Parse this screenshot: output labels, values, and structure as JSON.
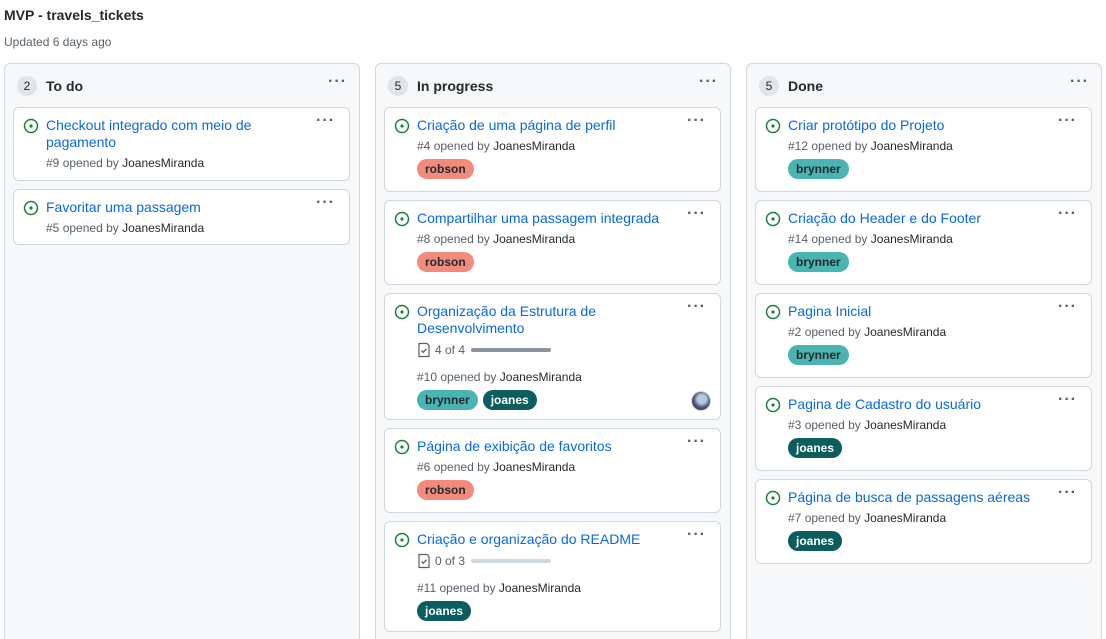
{
  "project": {
    "title": "MVP - travels_tickets",
    "updated": "Updated 6 days ago"
  },
  "colors": {
    "link": "#0969da",
    "issue_open": "#1a7f37",
    "robson": "#f28b7c",
    "brynner": "#49b4b2",
    "joanes": "#0b5e5d"
  },
  "icons": {
    "issue": "issue-opened-icon",
    "menu": "kebab-horizontal-icon",
    "checklist": "checklist-icon"
  },
  "columns": [
    {
      "count": "2",
      "name": "To do",
      "menu": "···",
      "cards": [
        {
          "title": "Checkout integrado com meio de pagamento",
          "number": "#9",
          "opened_by": "opened by",
          "author": "JoanesMiranda",
          "labels": []
        },
        {
          "title": "Favoritar uma passagem",
          "number": "#5",
          "opened_by": "opened by",
          "author": "JoanesMiranda",
          "labels": []
        }
      ]
    },
    {
      "count": "5",
      "name": "In progress",
      "menu": "···",
      "cards": [
        {
          "title": "Criação de uma página de perfil",
          "number": "#4",
          "opened_by": "opened by",
          "author": "JoanesMiranda",
          "labels": [
            "robson"
          ]
        },
        {
          "title": "Compartilhar uma passagem integrada",
          "number": "#8",
          "opened_by": "opened by",
          "author": "JoanesMiranda",
          "labels": [
            "robson"
          ]
        },
        {
          "title": "Organização da Estrutura de Desenvolvimento",
          "number": "#10",
          "opened_by": "opened by",
          "author": "JoanesMiranda",
          "labels": [
            "brynner",
            "joanes"
          ],
          "tasks": "4 of 4",
          "task_progress": 1.0,
          "has_avatar": true
        },
        {
          "title": "Página de exibição de favoritos",
          "number": "#6",
          "opened_by": "opened by",
          "author": "JoanesMiranda",
          "labels": [
            "robson"
          ]
        },
        {
          "title": "Criação e organização do README",
          "number": "#11",
          "opened_by": "opened by",
          "author": "JoanesMiranda",
          "labels": [
            "joanes"
          ],
          "tasks": "0 of 3",
          "task_progress": 0.0
        }
      ]
    },
    {
      "count": "5",
      "name": "Done",
      "menu": "···",
      "cards": [
        {
          "title": "Criar protótipo do Projeto",
          "number": "#12",
          "opened_by": "opened by",
          "author": "JoanesMiranda",
          "labels": [
            "brynner"
          ]
        },
        {
          "title": "Criação do Header e do Footer",
          "number": "#14",
          "opened_by": "opened by",
          "author": "JoanesMiranda",
          "labels": [
            "brynner"
          ]
        },
        {
          "title": "Pagina Inicial",
          "number": "#2",
          "opened_by": "opened by",
          "author": "JoanesMiranda",
          "labels": [
            "brynner"
          ]
        },
        {
          "title": "Pagina de Cadastro do usuário",
          "number": "#3",
          "opened_by": "opened by",
          "author": "JoanesMiranda",
          "labels": [
            "joanes"
          ]
        },
        {
          "title": "Página de busca de passagens aéreas",
          "number": "#7",
          "opened_by": "opened by",
          "author": "JoanesMiranda",
          "labels": [
            "joanes"
          ]
        }
      ]
    }
  ]
}
